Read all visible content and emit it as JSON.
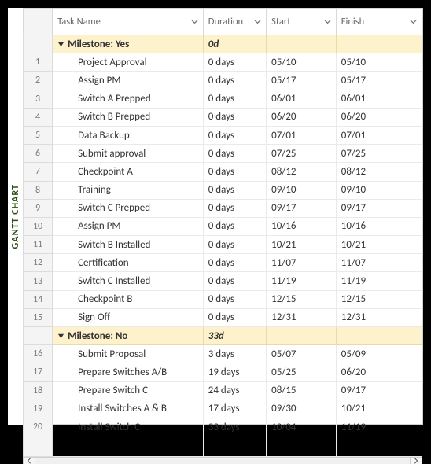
{
  "vertical_label": "GANTT CHART",
  "columns": {
    "task": "Task Name",
    "duration": "Duration",
    "start": "Start",
    "finish": "Finish"
  },
  "group_yes": {
    "label": "Milestone: Yes",
    "duration": "0d"
  },
  "rows_yes": [
    {
      "n": "1",
      "task": "Project Approval",
      "dur": "0 days",
      "start": "05/10",
      "finish": "05/10"
    },
    {
      "n": "2",
      "task": "Assign PM",
      "dur": "0 days",
      "start": "05/17",
      "finish": "05/17"
    },
    {
      "n": "3",
      "task": "Switch A Prepped",
      "dur": "0 days",
      "start": "06/01",
      "finish": "06/01"
    },
    {
      "n": "4",
      "task": "Switch B Prepped",
      "dur": "0 days",
      "start": "06/20",
      "finish": "06/20"
    },
    {
      "n": "5",
      "task": "Data Backup",
      "dur": "0 days",
      "start": "07/01",
      "finish": "07/01"
    },
    {
      "n": "6",
      "task": "Submit approval",
      "dur": "0 days",
      "start": "07/25",
      "finish": "07/25"
    },
    {
      "n": "7",
      "task": "Checkpoint A",
      "dur": "0 days",
      "start": "08/12",
      "finish": "08/12"
    },
    {
      "n": "8",
      "task": "Training",
      "dur": "0 days",
      "start": "09/10",
      "finish": "09/10"
    },
    {
      "n": "9",
      "task": "Switch C Prepped",
      "dur": "0 days",
      "start": "09/17",
      "finish": "09/17"
    },
    {
      "n": "10",
      "task": "Assign PM",
      "dur": "0 days",
      "start": "10/16",
      "finish": "10/16"
    },
    {
      "n": "11",
      "task": "Switch B Installed",
      "dur": "0 days",
      "start": "10/21",
      "finish": "10/21"
    },
    {
      "n": "12",
      "task": "Certification",
      "dur": "0 days",
      "start": "11/07",
      "finish": "11/07"
    },
    {
      "n": "13",
      "task": "Switch C Installed",
      "dur": "0 days",
      "start": "11/19",
      "finish": "11/19"
    },
    {
      "n": "14",
      "task": "Checkpoint B",
      "dur": "0 days",
      "start": "12/15",
      "finish": "12/15"
    },
    {
      "n": "15",
      "task": "Sign Off",
      "dur": "0 days",
      "start": "12/31",
      "finish": "12/31"
    }
  ],
  "group_no": {
    "label": "Milestone: No",
    "duration": "33d"
  },
  "rows_no": [
    {
      "n": "16",
      "task": "Submit Proposal",
      "dur": "3 days",
      "start": "05/07",
      "finish": "05/09"
    },
    {
      "n": "17",
      "task": "Prepare Switches A/B",
      "dur": "19 days",
      "start": "05/25",
      "finish": "06/20"
    },
    {
      "n": "18",
      "task": "Prepare Switch C",
      "dur": "24 days",
      "start": "08/15",
      "finish": "09/17"
    },
    {
      "n": "19",
      "task": "Install Switches A & B",
      "dur": "17 days",
      "start": "09/30",
      "finish": "10/21"
    },
    {
      "n": "20",
      "task": "Install Switch C",
      "dur": "33 days",
      "start": "10/04",
      "finish": "11/19"
    }
  ]
}
